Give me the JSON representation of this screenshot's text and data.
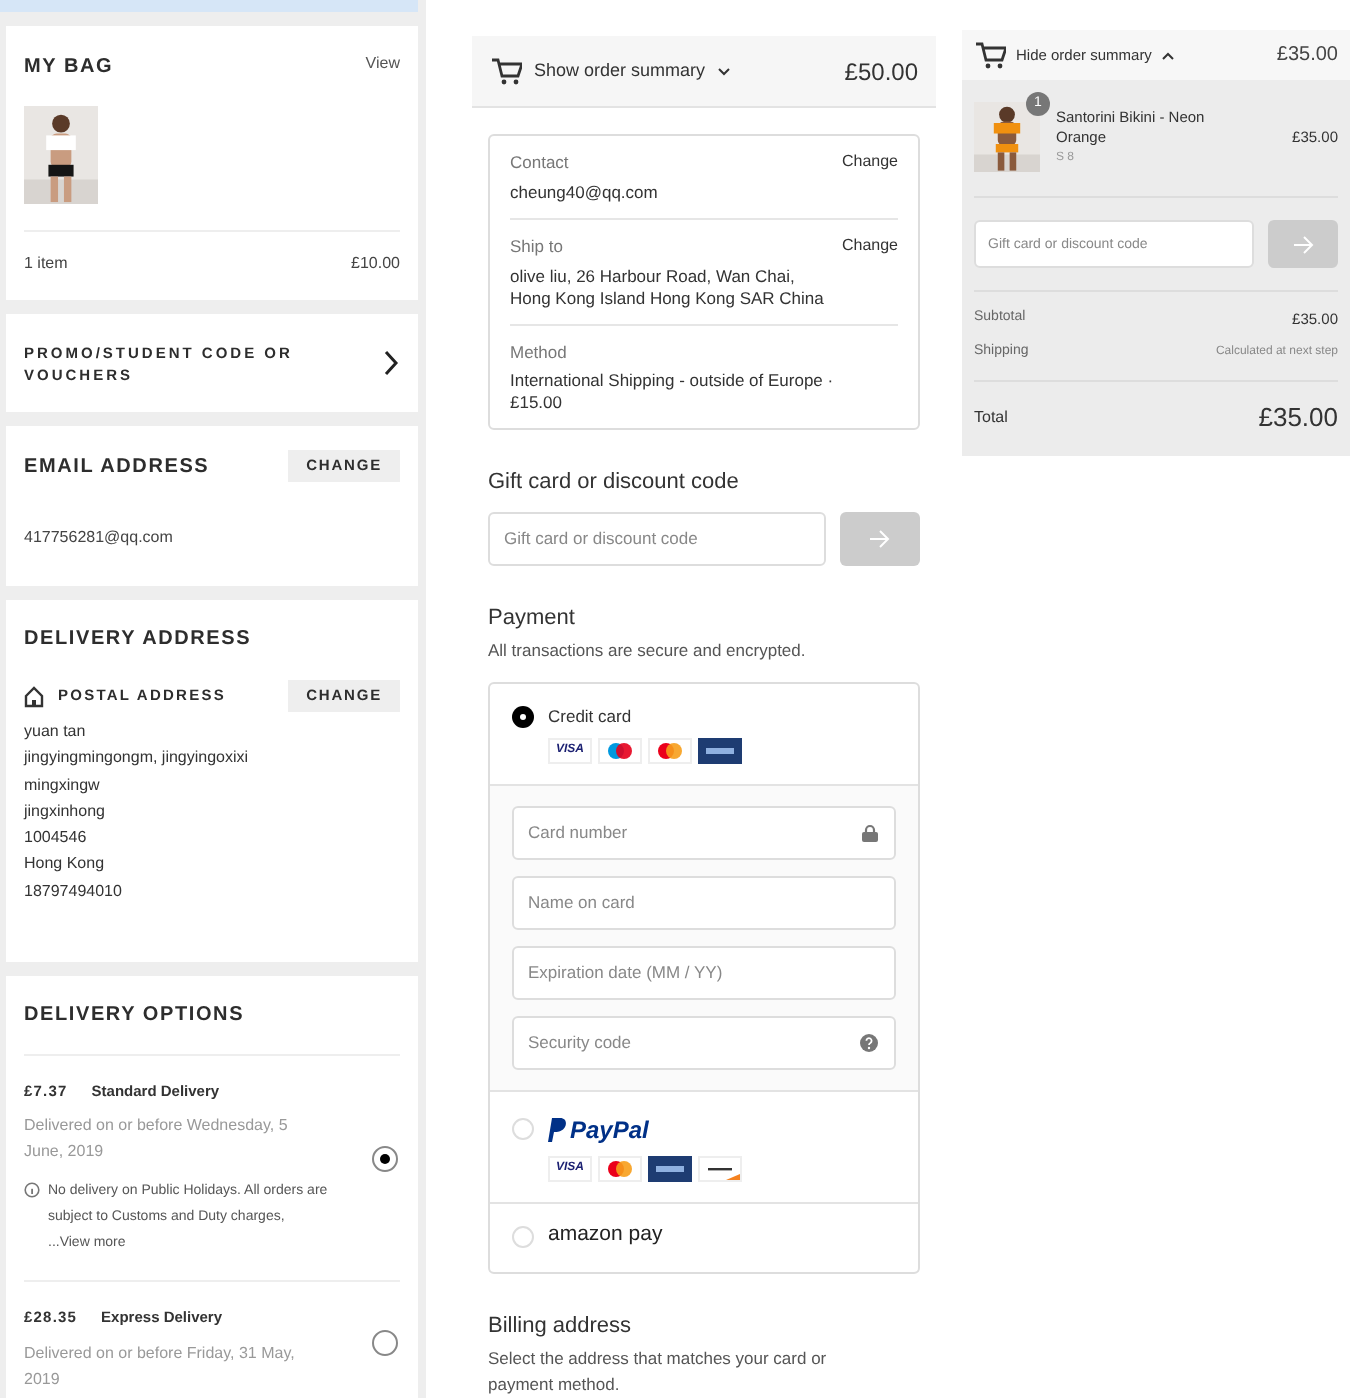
{
  "bag": {
    "title": "MY BAG",
    "view": "View",
    "count": "1 item",
    "total": "£10.00"
  },
  "promo": {
    "title": "PROMO/STUDENT CODE OR VOUCHERS"
  },
  "email": {
    "title": "EMAIL ADDRESS",
    "change": "CHANGE",
    "value": "417756281@qq.com"
  },
  "delivery_address": {
    "title": "DELIVERY ADDRESS",
    "subtitle": "POSTAL ADDRESS",
    "change": "CHANGE",
    "lines": [
      "yuan tan",
      "jingyingmingongm, jingyingoxixi",
      "mingxingw",
      "jingxinhong",
      "1004546",
      "Hong Kong",
      "18797494010"
    ]
  },
  "delivery_options": {
    "title": "DELIVERY OPTIONS",
    "options": [
      {
        "price": "£7.37",
        "name": "Standard Delivery",
        "eta": "Delivered on or before Wednesday, 5 June, 2019",
        "note": "No delivery on Public Holidays. All orders are subject to Customs and Duty charges,",
        "more": "...View more",
        "selected": true
      },
      {
        "price": "£28.35",
        "name": "Express Delivery",
        "eta": "Delivered on or before Friday, 31 May, 2019",
        "selected": false
      }
    ]
  },
  "checkout": {
    "summary_toggle": "Show order summary",
    "summary_total": "£50.00",
    "review": [
      {
        "label": "Contact",
        "value": "cheung40@qq.com",
        "action": "Change"
      },
      {
        "label": "Ship to",
        "value": "olive liu, 26 Harbour Road, Wan Chai, Hong Kong Island Hong Kong SAR China",
        "action": "Change"
      },
      {
        "label": "Method",
        "value": "International Shipping - outside of Europe · £15.00"
      }
    ],
    "gift": {
      "title": "Gift card or discount code",
      "placeholder": "Gift card or discount code"
    },
    "payment": {
      "title": "Payment",
      "subtitle": "All transactions are secure and encrypted.",
      "methods": [
        {
          "kind": "card",
          "label": "Credit card",
          "selected": true,
          "cards": [
            {
              "kind": "visa",
              "text": "VISA"
            },
            {
              "kind": "maestro"
            },
            {
              "kind": "mastercard"
            },
            {
              "kind": "amex"
            }
          ],
          "fields": [
            {
              "placeholder": "Card number",
              "kind": "card_number"
            },
            {
              "placeholder": "Name on card",
              "kind": "name"
            },
            {
              "placeholder": "Expiration date (MM / YY)",
              "kind": "expiry"
            },
            {
              "placeholder": "Security code",
              "kind": "security_code"
            }
          ]
        },
        {
          "kind": "paypal",
          "label": "PayPal",
          "selected": false,
          "cards": [
            {
              "kind": "visa",
              "text": "VISA"
            },
            {
              "kind": "mastercard"
            },
            {
              "kind": "amex"
            },
            {
              "kind": "discover"
            }
          ]
        },
        {
          "kind": "amazon",
          "label": "amazon pay",
          "selected": false
        }
      ]
    },
    "billing": {
      "title": "Billing address",
      "subtitle": "Select the address that matches your card or payment method."
    }
  },
  "summary": {
    "toggle": "Hide order summary",
    "total_top": "£35.00",
    "item": {
      "qty": "1",
      "name": "Santorini Bikini - Neon Orange",
      "variant": "S 8",
      "price": "£35.00"
    },
    "gift_placeholder": "Gift card or discount code",
    "lines": [
      {
        "label": "Subtotal",
        "value": "£35.00",
        "kind": "bold"
      },
      {
        "label": "Shipping",
        "value": "Calculated at next step",
        "kind": "note"
      }
    ],
    "total_label": "Total",
    "total": "£35.00"
  }
}
